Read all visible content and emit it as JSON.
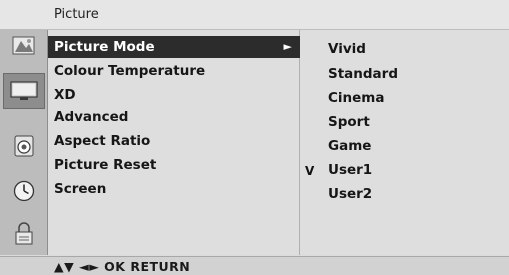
{
  "header": {
    "title": "Picture"
  },
  "sidebar": {
    "icons": [
      "picture-icon",
      "tv-screen-icon",
      "audio-speaker-icon",
      "clock-icon",
      "lock-icon"
    ]
  },
  "menu": {
    "items": [
      {
        "label": "Picture Mode",
        "selected": true,
        "arrow": "►"
      },
      {
        "label": "Colour Temperature"
      },
      {
        "label": "XD"
      },
      {
        "label": "Advanced"
      },
      {
        "label": "Aspect Ratio"
      },
      {
        "label": "Picture Reset"
      },
      {
        "label": "Screen"
      }
    ]
  },
  "options": {
    "items": [
      {
        "label": "Vivid"
      },
      {
        "label": "Standard"
      },
      {
        "label": "Cinema"
      },
      {
        "label": "Sport"
      },
      {
        "label": "Game"
      },
      {
        "label": "User1"
      },
      {
        "label": "User2"
      }
    ],
    "check_mark": "V",
    "checked_label": "User1"
  },
  "footer": {
    "hint": "▲▼  ◄►  OK   RETURN"
  },
  "colors": {
    "selected_bg": "#2c2c2c",
    "panel_bg": "#dedede",
    "sidebar_bg": "#bcbcbc"
  }
}
